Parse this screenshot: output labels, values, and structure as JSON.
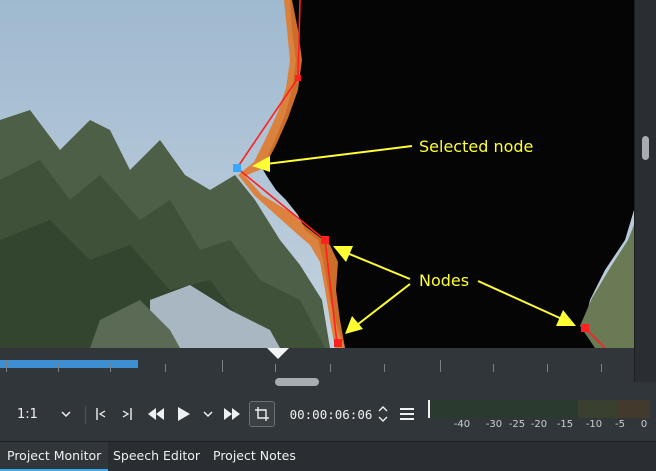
{
  "viewer": {
    "annotations": {
      "selected_node": "Selected node",
      "nodes": "Nodes"
    }
  },
  "toolbar": {
    "zoom_value": "1:1",
    "timecode": "00:00:06:06"
  },
  "audio_meter": {
    "labels": [
      "-40",
      "-30",
      "-25",
      "-20",
      "-15",
      "-10",
      "-5",
      "0"
    ]
  },
  "tabs": [
    {
      "label": "Project Monitor",
      "active": true
    },
    {
      "label": "Speech Editor",
      "active": false
    },
    {
      "label": "Project Notes",
      "active": false
    }
  ],
  "colors": {
    "accent": "#3daee9",
    "mask_outline": "#ff2020",
    "selected_node": "#3aa6ff",
    "annotation": "#ffff33"
  }
}
